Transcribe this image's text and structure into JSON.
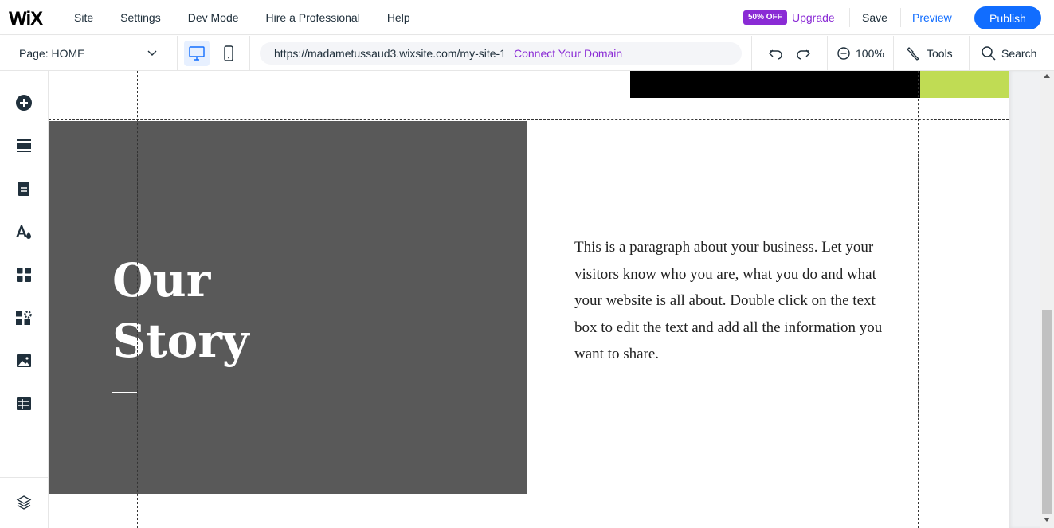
{
  "app": {
    "logo": "WiX"
  },
  "topmenu": {
    "items": [
      "Site",
      "Settings",
      "Dev Mode",
      "Hire a Professional",
      "Help"
    ],
    "sale_badge": "50% OFF",
    "upgrade": "Upgrade",
    "save": "Save",
    "preview": "Preview",
    "publish": "Publish"
  },
  "secondbar": {
    "page_label": "Page: HOME",
    "url": "https://madametussaud3.wixsite.com/my-site-1",
    "connect_domain": "Connect Your Domain",
    "zoom": "100%",
    "tools": "Tools",
    "search": "Search"
  },
  "sidebar": {
    "icons": [
      "add-icon",
      "sections-icon",
      "pages-icon",
      "theme-icon",
      "apps-icon",
      "business-apps-icon",
      "media-icon",
      "cms-icon",
      "layers-icon"
    ]
  },
  "canvas": {
    "story_title_line1": "Our",
    "story_title_line2": "Story",
    "paragraph": "This is a paragraph about your business. Let your visitors know who you are, what you do and what your website is all about. Double click on the text box to edit the text and add all the information you want to share.",
    "colors": {
      "panel": "#595959",
      "accent_green": "#c0dc54",
      "black_strip": "#000000"
    }
  },
  "colors": {
    "brand_blue": "#116dff",
    "upgrade_purple": "#8a2bd5"
  }
}
